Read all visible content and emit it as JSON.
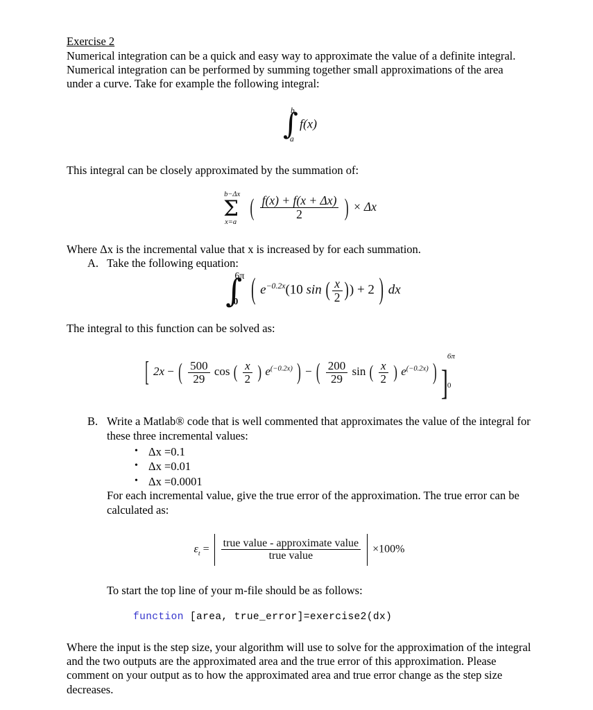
{
  "document": {
    "title": "Exercise 2",
    "intro_paragraph": "Numerical integration can be a quick and easy way to approximate the value of a definite integral.  Numerical integration can be performed by summing together small approximations of the area under a curve.  Take for example the following integral:",
    "integral_definite": {
      "lower_limit": "a",
      "upper_limit": "b",
      "integrand": "f(x)",
      "integral_symbol": "∫"
    },
    "approx_intro": "This integral can be closely approximated by the summation of:",
    "summation_formula": {
      "sigma_symbol": "Σ",
      "upper_limit": "b−Δx",
      "lower_limit": "x=a",
      "numerator": "f(x) + f(x + Δx)",
      "denominator": "2",
      "multiplier": "× Δx"
    },
    "where_line": "Where  Δx  is the incremental value that x is increased by for each summation.",
    "items": [
      {
        "marker": "A.",
        "text": "Take the following equation:"
      },
      {
        "marker": "B.",
        "text": "Write a Matlab® code that is well commented that approximates the value of the integral for these three incremental values:"
      }
    ],
    "equation_a": {
      "integral_symbol": "∫",
      "lower_limit": "0",
      "upper_limit": "6π",
      "exp_base": "e",
      "exp_power": "−0.2x",
      "coefficient": "10",
      "trig": "sin",
      "arg_num": "x",
      "arg_den": "2",
      "constant": "+ 2",
      "differential": "dx"
    },
    "solved_intro": "The integral to this function can be solved as:",
    "solved_integral": {
      "first_term": "2x",
      "minus": "−",
      "term1_num": "500",
      "term1_den": "29",
      "term1_trig": "cos",
      "term1_arg_num": "x",
      "term1_arg_den": "2",
      "term1_exp": "e",
      "term1_exp_power": "(−0.2x)",
      "term2_num": "200",
      "term2_den": "29",
      "term2_trig": "sin",
      "term2_arg_num": "x",
      "term2_arg_den": "2",
      "term2_exp": "e",
      "term2_exp_power": "(−0.2x)",
      "eval_upper": "6π",
      "eval_lower": "0"
    },
    "increment_values": [
      "Δx =0.1",
      "Δx =0.01",
      "Δx =0.0001"
    ],
    "true_error_intro": "For each incremental value, give the true error of the approximation.  The true error can be calculated as:",
    "true_error_formula": {
      "symbol": "ε",
      "subscript": "t",
      "equals": "=",
      "numerator": "true value - approximate value",
      "denominator": "true value",
      "multiplier": "×100%"
    },
    "mfile_intro": "To start the top line of your m-file should be as follows:",
    "code": {
      "keyword": "function",
      "rest": "[area, true_error]=exercise2(dx)",
      "keyword_color": "#3333cc"
    },
    "closing_paragraph": "Where the input is the step size, your algorithm will use to solve for the approximation of the integral and the two outputs are the approximated area and the true error of this approximation.  Please comment on your output as to how the approximated area and true error change as the step size decreases."
  }
}
